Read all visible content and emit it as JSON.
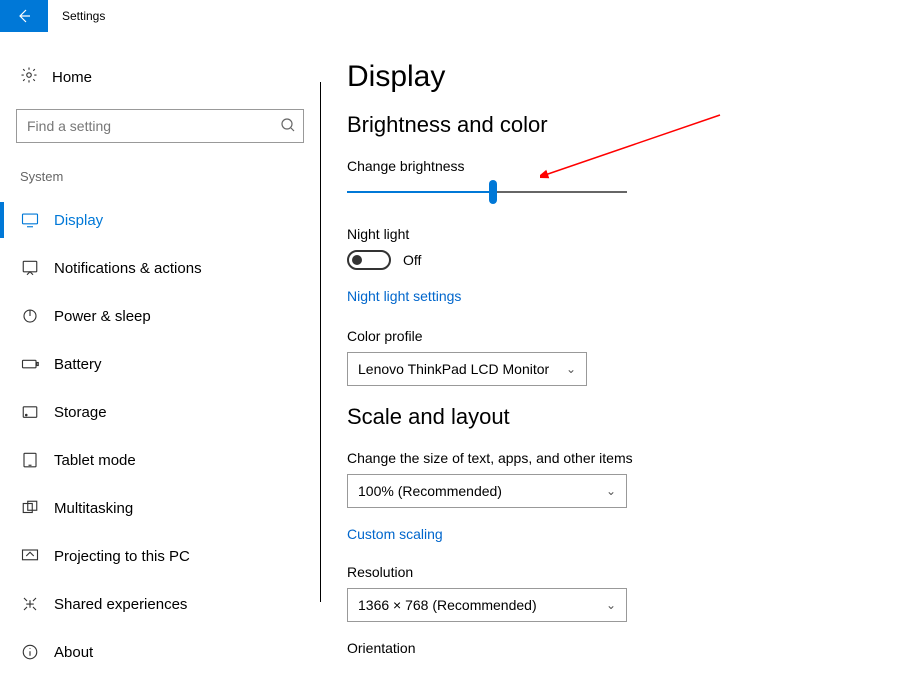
{
  "titlebar": {
    "title": "Settings"
  },
  "sidebar": {
    "home_label": "Home",
    "search_placeholder": "Find a setting",
    "section_label": "System",
    "items": [
      {
        "label": "Display"
      },
      {
        "label": "Notifications & actions"
      },
      {
        "label": "Power & sleep"
      },
      {
        "label": "Battery"
      },
      {
        "label": "Storage"
      },
      {
        "label": "Tablet mode"
      },
      {
        "label": "Multitasking"
      },
      {
        "label": "Projecting to this PC"
      },
      {
        "label": "Shared experiences"
      },
      {
        "label": "About"
      }
    ]
  },
  "main": {
    "page_title": "Display",
    "brightness_section_title": "Brightness and color",
    "brightness_label": "Change brightness",
    "brightness_percent": 52,
    "night_light_label": "Night light",
    "night_light_toggle_state": "Off",
    "night_light_settings_link": "Night light settings",
    "color_profile_label": "Color profile",
    "color_profile_value": "Lenovo ThinkPad LCD Monitor",
    "scale_section_title": "Scale and layout",
    "scale_label": "Change the size of text, apps, and other items",
    "scale_value": "100% (Recommended)",
    "custom_scaling_link": "Custom scaling",
    "resolution_label": "Resolution",
    "resolution_value": "1366 × 768 (Recommended)",
    "orientation_label": "Orientation"
  }
}
